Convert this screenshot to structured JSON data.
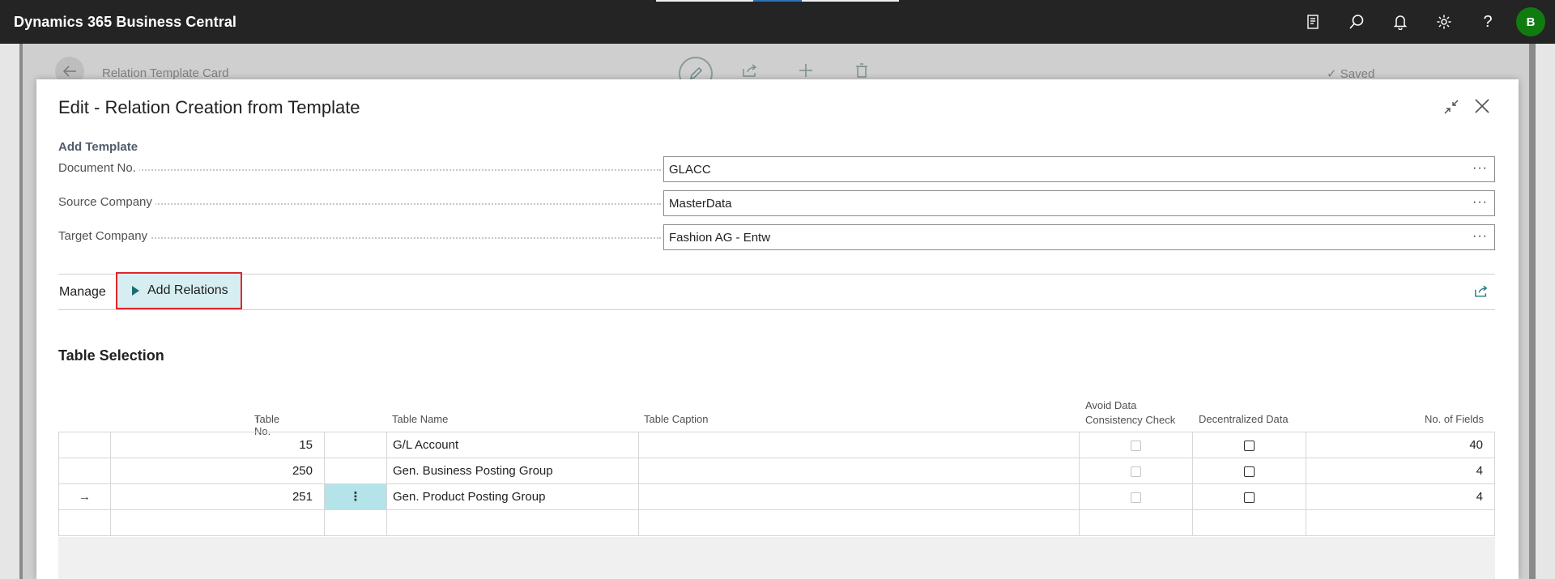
{
  "app": {
    "title": "Dynamics 365 Business Central",
    "avatar_initial": "B"
  },
  "topbar_icons": [
    "document-icon",
    "search-icon",
    "bell-icon",
    "gear-icon",
    "help-icon"
  ],
  "background_page": {
    "breadcrumb": "Relation Template Card",
    "status": "Saved"
  },
  "dialog": {
    "title": "Edit - Relation Creation from Template",
    "section": "Add Template",
    "fields": [
      {
        "label": "Document No.",
        "value": "GLACC"
      },
      {
        "label": "Source Company",
        "value": "MasterData"
      },
      {
        "label": "Target Company",
        "value": "Fashion AG - Entw"
      }
    ],
    "actions": {
      "manage_label": "Manage",
      "add_relations_label": "Add Relations"
    },
    "table": {
      "title": "Table Selection",
      "headers": {
        "table_no": "Table No.",
        "sort_indicator": "↑",
        "table_name": "Table Name",
        "table_caption": "Table Caption",
        "avoid_check_1": "Avoid Data",
        "avoid_check_2": "Consistency Check",
        "decentralized": "Decentralized Data",
        "no_of_fields": "No. of Fields"
      },
      "rows": [
        {
          "marker": "",
          "table_no": "15",
          "name": "G/L Account",
          "caption": "",
          "avoid_check": false,
          "decentralized": false,
          "fields": "40"
        },
        {
          "marker": "",
          "table_no": "250",
          "name": "Gen. Business Posting Group",
          "caption": "",
          "avoid_check": false,
          "decentralized": false,
          "fields": "4"
        },
        {
          "marker": "→",
          "table_no": "251",
          "name": "Gen. Product Posting Group",
          "caption": "",
          "avoid_check": false,
          "decentralized": false,
          "fields": "4",
          "row_menu": "⋮"
        }
      ]
    }
  }
}
